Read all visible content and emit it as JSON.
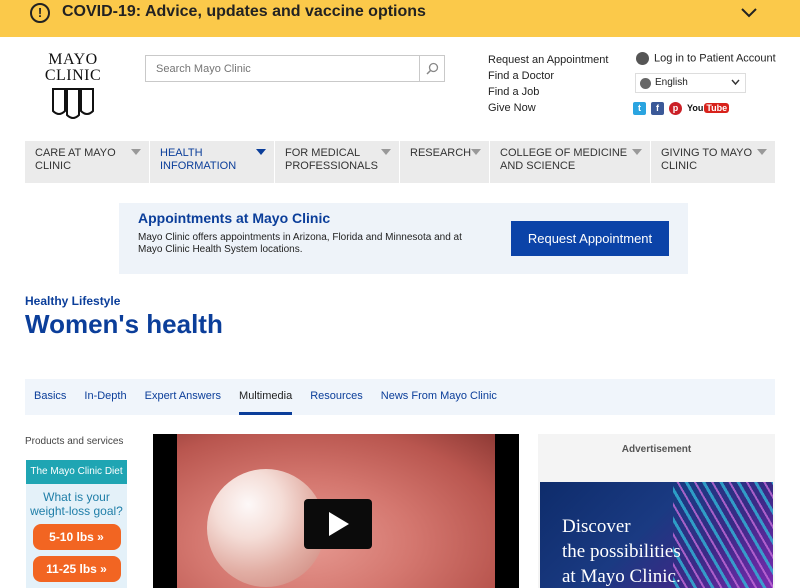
{
  "covid_banner": {
    "text": "COVID-19: Advice, updates and vaccine options",
    "icon": "alert-circle-icon",
    "background": "#fbc94a"
  },
  "logo": {
    "line1": "MAYO",
    "line2": "CLINIC"
  },
  "search": {
    "placeholder": "Search Mayo Clinic",
    "icon": "search-icon"
  },
  "quick_links": [
    "Request an Appointment",
    "Find a Doctor",
    "Find a Job",
    "Give Now"
  ],
  "account": {
    "login_label": "Log in to Patient Account",
    "language": "English"
  },
  "social": {
    "twitter": "t",
    "facebook": "f",
    "pinterest": "p",
    "youtube_you": "You",
    "youtube_tube": "Tube"
  },
  "nav": [
    {
      "label": "CARE AT MAYO CLINIC",
      "active": false
    },
    {
      "label": "HEALTH INFORMATION",
      "active": true
    },
    {
      "label": "FOR MEDICAL PROFESSIONALS",
      "active": false
    },
    {
      "label": "RESEARCH",
      "active": false
    },
    {
      "label": "COLLEGE OF MEDICINE AND SCIENCE",
      "active": false
    },
    {
      "label": "GIVING TO MAYO CLINIC",
      "active": false
    }
  ],
  "appointment": {
    "heading": "Appointments at Mayo Clinic",
    "body": "Mayo Clinic offers appointments in Arizona, Florida and Minnesota and at Mayo Clinic Health System locations.",
    "button": "Request Appointment",
    "button_color": "#0b43a8"
  },
  "page": {
    "kicker": "Healthy Lifestyle",
    "title": "Women's health",
    "accent": "#0b3e9a"
  },
  "tabs": [
    {
      "label": "Basics",
      "active": false
    },
    {
      "label": "In-Depth",
      "active": false
    },
    {
      "label": "Expert Answers",
      "active": false
    },
    {
      "label": "Multimedia",
      "active": true
    },
    {
      "label": "Resources",
      "active": false
    },
    {
      "label": "News From Mayo Clinic",
      "active": false
    }
  ],
  "products": {
    "label": "Products and services",
    "diet_header": "The Mayo Clinic Diet",
    "diet_question": "What is your weight-loss goal?",
    "options": [
      "5-10 lbs »",
      "11-25 lbs »"
    ]
  },
  "video": {
    "play_icon": "play-icon"
  },
  "ad": {
    "label": "Advertisement",
    "line1": "Discover",
    "line2": "the possibilities",
    "line3": "at Mayo Clinic."
  }
}
